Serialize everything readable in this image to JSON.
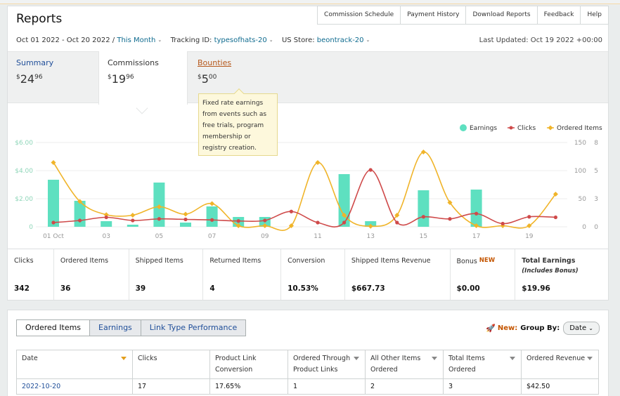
{
  "header": {
    "title": "Reports",
    "links": [
      "Commission Schedule",
      "Payment History",
      "Download Reports",
      "Feedback",
      "Help"
    ]
  },
  "filters": {
    "date_range": "Oct 01 2022 - Oct 20 2022",
    "date_preset": "This Month",
    "tracking_label": "Tracking ID:",
    "tracking_value": "typesofhats-20",
    "store_label": "US Store:",
    "store_value": "beontrack-20",
    "last_updated": "Last Updated: Oct 19 2022 +00:00"
  },
  "summary_tabs": [
    {
      "label": "Summary",
      "currency": "$",
      "whole": "24",
      "cents": "96"
    },
    {
      "label": "Commissions",
      "currency": "$",
      "whole": "19",
      "cents": "96"
    },
    {
      "label": "Bounties",
      "currency": "$",
      "whole": "5",
      "cents": "00"
    }
  ],
  "tooltip": {
    "text": "Fixed rate earnings from events such as free trials, program membership or registry creation."
  },
  "chart_data": {
    "type": "bar",
    "categories": [
      "01 Oct",
      "02",
      "03",
      "04",
      "05",
      "06",
      "07",
      "08",
      "09",
      "10",
      "11",
      "12",
      "13",
      "14",
      "15",
      "16",
      "17",
      "18",
      "19",
      "20"
    ],
    "x_tick_labels": [
      "01 Oct",
      "",
      "03",
      "",
      "05",
      "",
      "07",
      "",
      "09",
      "",
      "11",
      "",
      "13",
      "",
      "15",
      "",
      "17",
      "",
      "19",
      ""
    ],
    "series": [
      {
        "name": "Earnings",
        "type": "bar",
        "axis": "left",
        "color": "#5ee0c0",
        "values": [
          3.35,
          1.85,
          0.4,
          0.15,
          3.15,
          0.3,
          1.45,
          0.7,
          0.7,
          0,
          0,
          3.75,
          0.4,
          0,
          2.6,
          0,
          2.65,
          0,
          0,
          0
        ]
      },
      {
        "name": "Clicks",
        "type": "line",
        "axis": "right",
        "color": "#cf4a4a",
        "values": [
          0.4,
          0.6,
          0.9,
          0.6,
          0.75,
          0.7,
          0.65,
          0.55,
          0.6,
          1.45,
          0.4,
          0.4,
          5.4,
          0.4,
          0.95,
          0.75,
          1.25,
          0.3,
          0.95,
          0.9
        ]
      },
      {
        "name": "Ordered Items",
        "type": "line",
        "axis": "right",
        "color": "#f0b429",
        "values": [
          6.1,
          2.4,
          1.15,
          1.1,
          1.9,
          1.2,
          2.2,
          0.1,
          0.1,
          0.1,
          6.1,
          1.1,
          0.05,
          1.1,
          7.1,
          2.3,
          0.1,
          0.1,
          0.1,
          3.1
        ]
      }
    ],
    "y_left": {
      "ticks": [
        "$6.00",
        "$4.00",
        "$2.00",
        "0"
      ],
      "range": [
        0,
        6
      ]
    },
    "y_right_a": {
      "ticks": [
        "150",
        "100",
        "50",
        "0"
      ],
      "range": [
        0,
        150
      ]
    },
    "y_right_b": {
      "ticks": [
        "8",
        "5",
        "3",
        "0"
      ],
      "range": [
        0,
        8
      ]
    },
    "legend_position": "top-right",
    "grid": true
  },
  "metrics": [
    {
      "label": "Clicks",
      "value": "342"
    },
    {
      "label": "Ordered Items",
      "value": "36"
    },
    {
      "label": "Shipped Items",
      "value": "39"
    },
    {
      "label": "Returned Items",
      "value": "4"
    },
    {
      "label": "Conversion",
      "value": "10.53%"
    },
    {
      "label": "Shipped Items Revenue",
      "value": "$667.73"
    },
    {
      "label": "Bonus",
      "badge": "NEW",
      "value": "$0.00"
    },
    {
      "label": "Total Earnings",
      "sub": "(Includes Bonus)",
      "value": "$19.96"
    }
  ],
  "report": {
    "tabs": [
      "Ordered Items",
      "Earnings",
      "Link Type Performance"
    ],
    "group_new": "New:",
    "group_label": "Group By:",
    "group_value": "Date",
    "columns": [
      [
        "Date",
        ""
      ],
      [
        "Clicks",
        ""
      ],
      [
        "Product Link",
        "Conversion"
      ],
      [
        "Ordered Through",
        "Product Links"
      ],
      [
        "All Other Items",
        "Ordered"
      ],
      [
        "Total Items",
        "Ordered"
      ],
      [
        "Ordered Revenue",
        ""
      ]
    ],
    "rows": [
      [
        "2022-10-20",
        "17",
        "17.65%",
        "1",
        "2",
        "3",
        "$42.50"
      ]
    ]
  }
}
